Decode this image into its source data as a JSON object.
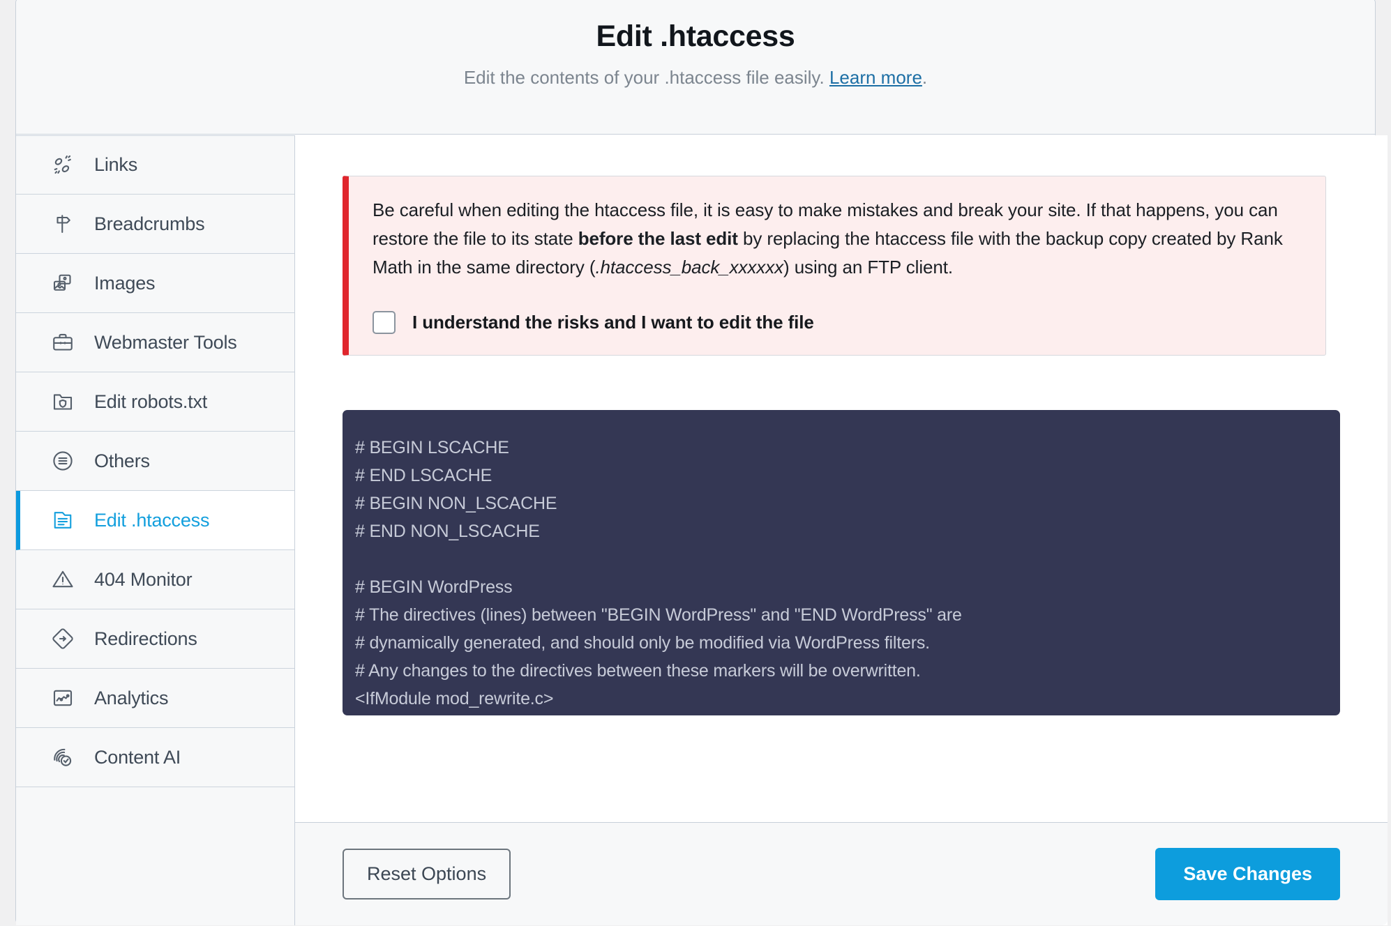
{
  "header": {
    "title": "Edit .htaccess",
    "subtitle_before": "Edit the contents of your .htaccess file easily. ",
    "link_label": "Learn more",
    "subtitle_after": "."
  },
  "sidebar": {
    "items": [
      {
        "label": "Links",
        "icon": "links-icon",
        "active": false
      },
      {
        "label": "Breadcrumbs",
        "icon": "signpost-icon",
        "active": false
      },
      {
        "label": "Images",
        "icon": "images-icon",
        "active": false
      },
      {
        "label": "Webmaster Tools",
        "icon": "briefcase-icon",
        "active": false
      },
      {
        "label": "Edit robots.txt",
        "icon": "folder-shield-icon",
        "active": false
      },
      {
        "label": "Others",
        "icon": "circle-lines-icon",
        "active": false
      },
      {
        "label": "Edit .htaccess",
        "icon": "file-lines-icon",
        "active": true
      },
      {
        "label": "404 Monitor",
        "icon": "warning-triangle-icon",
        "active": false
      },
      {
        "label": "Redirections",
        "icon": "diamond-arrow-icon",
        "active": false
      },
      {
        "label": "Analytics",
        "icon": "chart-square-icon",
        "active": false
      },
      {
        "label": "Content AI",
        "icon": "fingerprint-check-icon",
        "active": false
      }
    ]
  },
  "notice": {
    "line1": "Be careful when editing the htaccess file, it is easy to make mistakes and break your site. If that happens, you can restore the file to its state ",
    "bold1": "before the last edit",
    "line2": " by replacing the htaccess file with the backup copy created by Rank Math in the same directory (",
    "italic1": ".htaccess_back_xxxxxx",
    "line3": ") using an FTP client.",
    "checkbox_label": "I understand the risks and I want to edit the file",
    "checkbox_checked": false
  },
  "editor": {
    "content": "# BEGIN LSCACHE\n# END LSCACHE\n# BEGIN NON_LSCACHE\n# END NON_LSCACHE\n\n# BEGIN WordPress\n# The directives (lines) between \"BEGIN WordPress\" and \"END WordPress\" are\n# dynamically generated, and should only be modified via WordPress filters.\n# Any changes to the directives between these markers will be overwritten.\n<IfModule mod_rewrite.c>\nRewriteEngine On"
  },
  "footer": {
    "reset_label": "Reset Options",
    "save_label": "Save Changes"
  },
  "colors": {
    "accent": "#0d9ddd",
    "danger": "#e0262d",
    "editor_bg": "#343754",
    "notice_bg": "#fdeeee"
  }
}
